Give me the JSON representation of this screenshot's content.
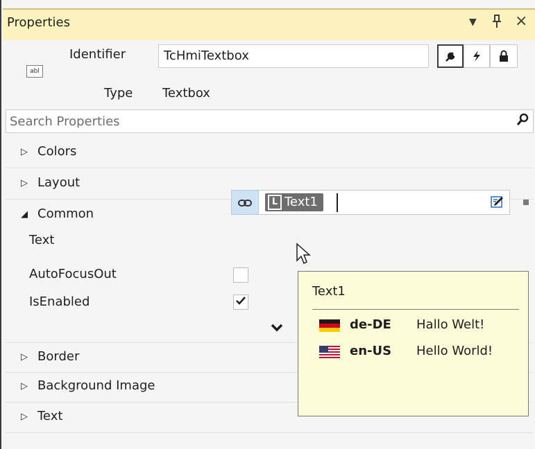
{
  "panel": {
    "title": "Properties"
  },
  "titlebar_icons": {
    "dropdown": "▾",
    "pin": "ꟼ",
    "close": "×"
  },
  "header": {
    "identifier_label": "Identifier",
    "identifier_value": "TcHmiTextbox",
    "type_label": "Type",
    "type_value": "Textbox",
    "control_icon_text": "abl"
  },
  "mode_buttons": [
    {
      "name": "properties-mode",
      "icon": "wrench-icon",
      "active": true
    },
    {
      "name": "events-mode",
      "icon": "lightning-icon",
      "active": false
    },
    {
      "name": "permissions-mode",
      "icon": "lock-icon",
      "active": false
    }
  ],
  "search": {
    "placeholder": "Search Properties"
  },
  "categories": {
    "colors": "Colors",
    "layout": "Layout",
    "common": "Common",
    "border": "Border",
    "background_image": "Background Image",
    "text": "Text"
  },
  "common": {
    "text_label": "Text",
    "text_value": "Text1",
    "text_chip_letter": "L",
    "autofocusout_label": "AutoFocusOut",
    "autofocusout_checked": false,
    "isenabled_label": "IsEnabled",
    "isenabled_checked": true
  },
  "tooltip": {
    "title": "Text1",
    "rows": [
      {
        "lang": "de-DE",
        "value": "Hallo Welt!",
        "flag": "germany-flag"
      },
      {
        "lang": "en-US",
        "value": "Hello World!",
        "flag": "us-flag"
      }
    ]
  },
  "colors": {
    "title_bg": "#fdf3bf",
    "tooltip_bg": "#fcfcd9",
    "bind_button_bg": "#cfe3f7"
  }
}
